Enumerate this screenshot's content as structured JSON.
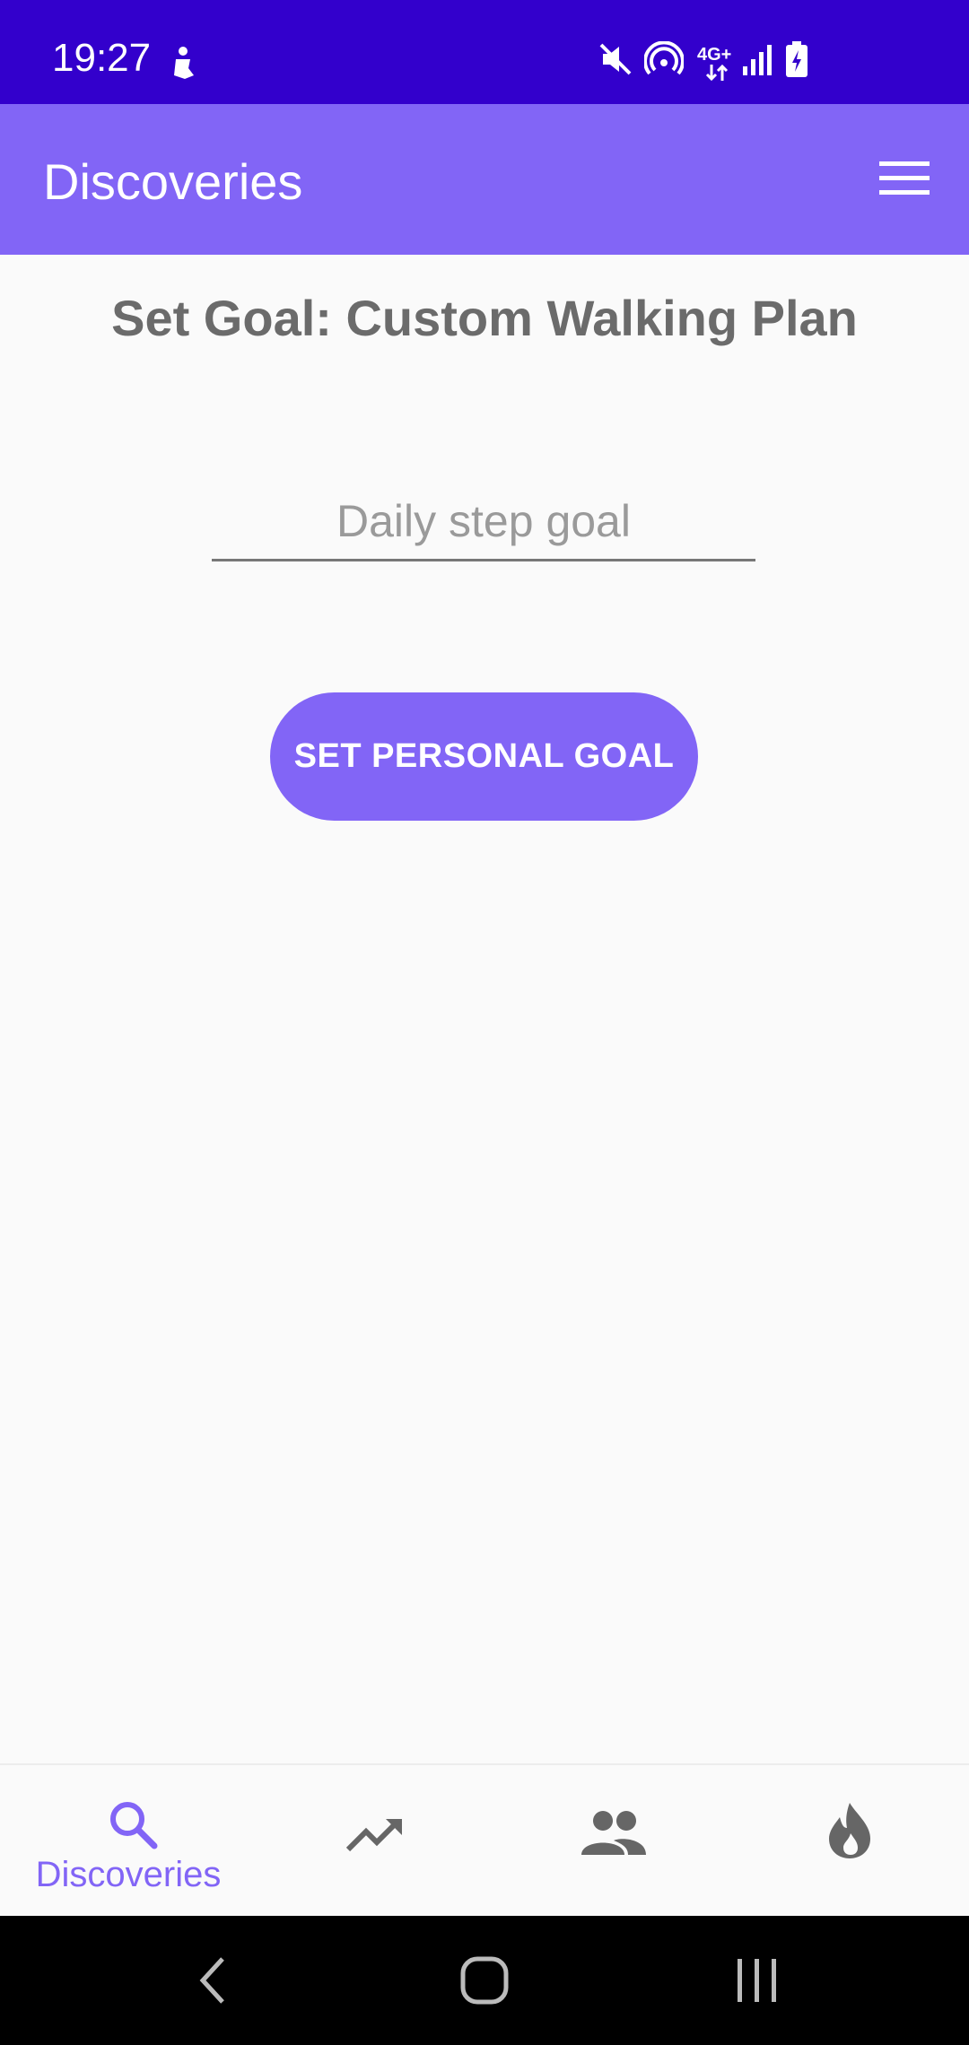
{
  "status_bar": {
    "time": "19:27",
    "network": "4G+",
    "icons": [
      "notification-icon",
      "mute-icon",
      "hotspot-icon",
      "network-icon",
      "signal-icon",
      "battery-charging-icon"
    ]
  },
  "app_bar": {
    "title": "Discoveries",
    "menu_icon": "menu-icon"
  },
  "main": {
    "title": "Set Goal: Custom Walking Plan",
    "step_input": {
      "placeholder": "Daily step goal",
      "value": ""
    },
    "set_goal_button": "SET PERSONAL GOAL"
  },
  "bottom_nav": {
    "items": [
      {
        "icon": "search-icon",
        "label": "Discoveries",
        "active": true
      },
      {
        "icon": "trending-up-icon",
        "label": "",
        "active": false
      },
      {
        "icon": "people-icon",
        "label": "",
        "active": false
      },
      {
        "icon": "flame-icon",
        "label": "",
        "active": false
      }
    ]
  },
  "system_nav": {
    "icons": [
      "back-icon",
      "home-icon",
      "recents-icon"
    ]
  },
  "colors": {
    "status_bar": "#3300cc",
    "accent": "#8265f6",
    "title_text": "#6b6b6b",
    "inactive_icon": "#666666",
    "background": "#fafafa"
  }
}
